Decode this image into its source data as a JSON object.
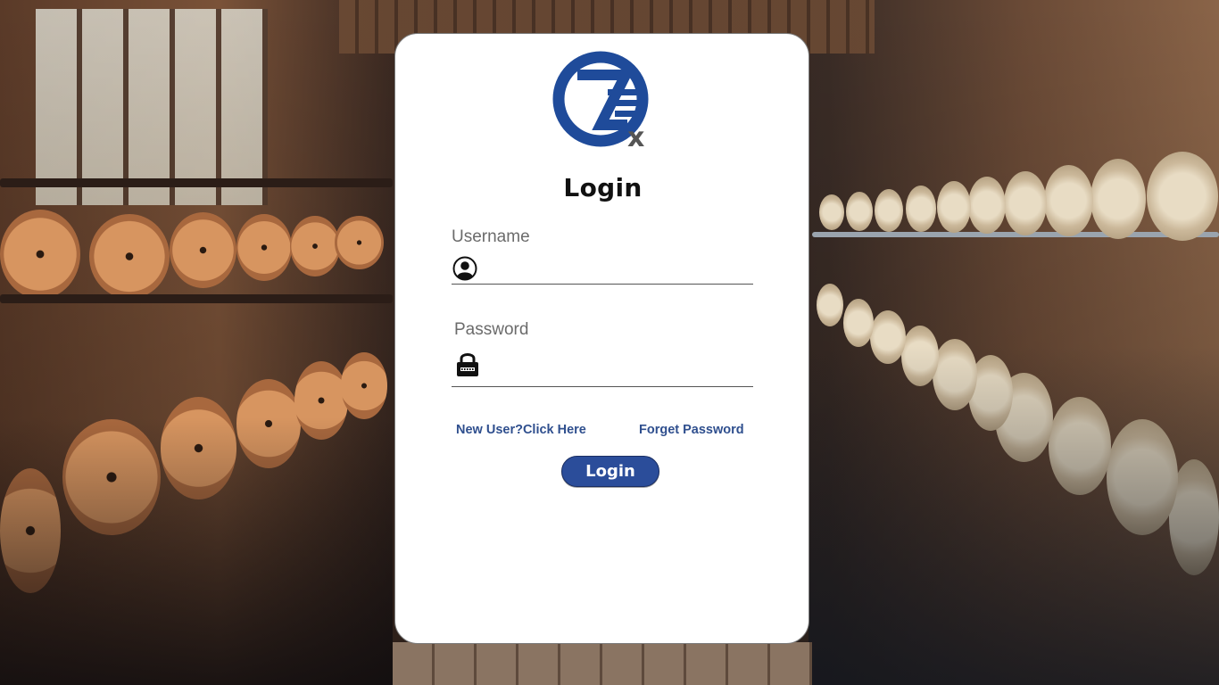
{
  "page": {
    "title": "Login",
    "accent_color": "#2b4d9a",
    "link_color": "#2f4f8e",
    "card_background": "#ffffff"
  },
  "logo": {
    "icon": "zex-logo-icon",
    "mark_text": "x",
    "brand_color": "#1f4b9a"
  },
  "form": {
    "username": {
      "label": "Username",
      "icon": "user-circle-icon",
      "value": "",
      "placeholder": ""
    },
    "password": {
      "label": "Password",
      "icon": "padlock-icon",
      "value": "",
      "placeholder": ""
    }
  },
  "links": {
    "new_user": "New User?Click Here",
    "forgot_password": "Forget Password"
  },
  "actions": {
    "login_label": "Login"
  }
}
